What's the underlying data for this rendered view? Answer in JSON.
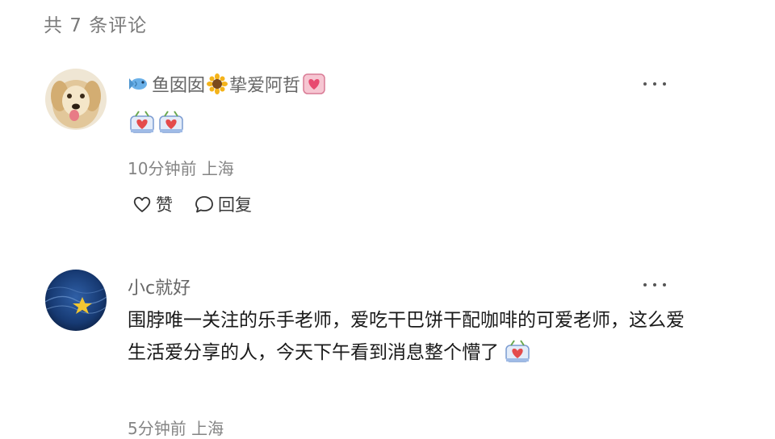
{
  "header": {
    "comment_count": "共 7 条评论"
  },
  "comments": [
    {
      "username_part1": "鱼囡囡",
      "username_part2": "挚爱阿哲",
      "emojis": [
        "carrot-heart-emoji",
        "carrot-heart-emoji"
      ],
      "time": "10分钟前",
      "location": "上海",
      "like_label": "赞",
      "reply_label": "回复"
    },
    {
      "username": "小c就好",
      "text": "围脖唯一关注的乐手老师，爱吃干巴饼干配咖啡的可爱老师，这么爱生活爱分享的人，今天下午看到消息整个懵了",
      "time": "5分钟前",
      "location": "上海"
    }
  ],
  "icons": {
    "fish": "fish-emoji",
    "sunflower": "sunflower-emoji",
    "heart_box": "heart-box-emoji",
    "more": "more-dots-icon",
    "like": "heart-outline-icon",
    "reply": "comment-bubble-icon"
  },
  "colors": {
    "header_text": "#7a7a7a",
    "username_text": "#666666",
    "meta_text": "#858585",
    "body_text": "#1a1a1a"
  }
}
